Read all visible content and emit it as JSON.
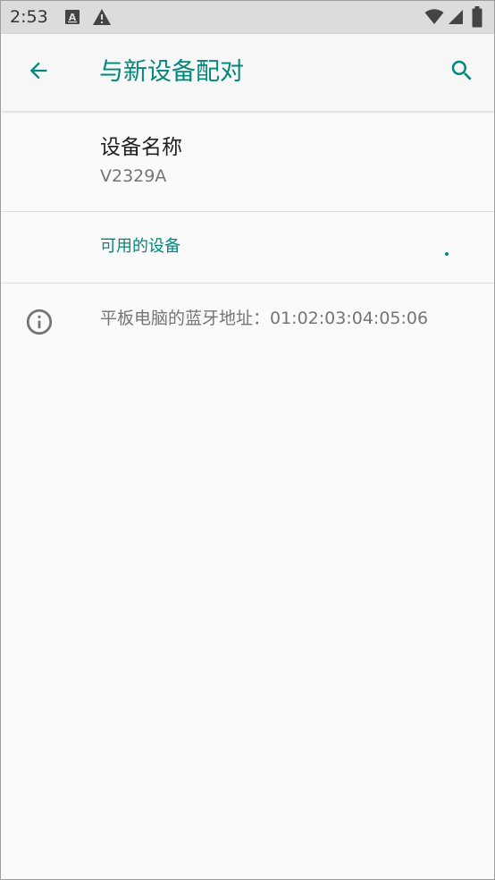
{
  "status_bar": {
    "time": "2:53",
    "icons": [
      "a-notification-icon",
      "warning-icon",
      "wifi-icon",
      "signal-icon",
      "battery-icon"
    ]
  },
  "app_bar": {
    "back_icon": "arrow-back-icon",
    "title": "与新设备配对",
    "search_icon": "search-icon"
  },
  "device_name": {
    "title": "设备名称",
    "value": "V2329A"
  },
  "available_devices": {
    "header": "可用的设备"
  },
  "info": {
    "icon": "info-icon",
    "text": "平板电脑的蓝牙地址：01:02:03:04:05:06"
  },
  "colors": {
    "accent": "#00897b",
    "status_bar_bg": "#dcdcdc",
    "app_bar_bg": "#f7f7f7",
    "background": "#fafafa",
    "primary_text": "#212121",
    "secondary_text": "#757575",
    "divider": "#dddddd"
  }
}
